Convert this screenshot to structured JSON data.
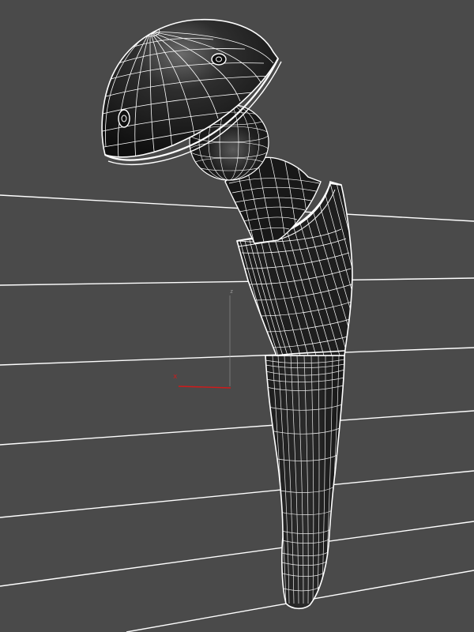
{
  "viewport": {
    "background_color": "#4a4a4a",
    "grid_line_color": "#ffffff",
    "wireframe_color": "#ffffff",
    "model_surface_color": "#151515",
    "model_highlight_color": "#6a6a6a"
  },
  "gizmo": {
    "x_label": "x",
    "z_label": "z",
    "x_axis_color": "#d11a1a",
    "z_axis_color": "#9a9a9a"
  }
}
